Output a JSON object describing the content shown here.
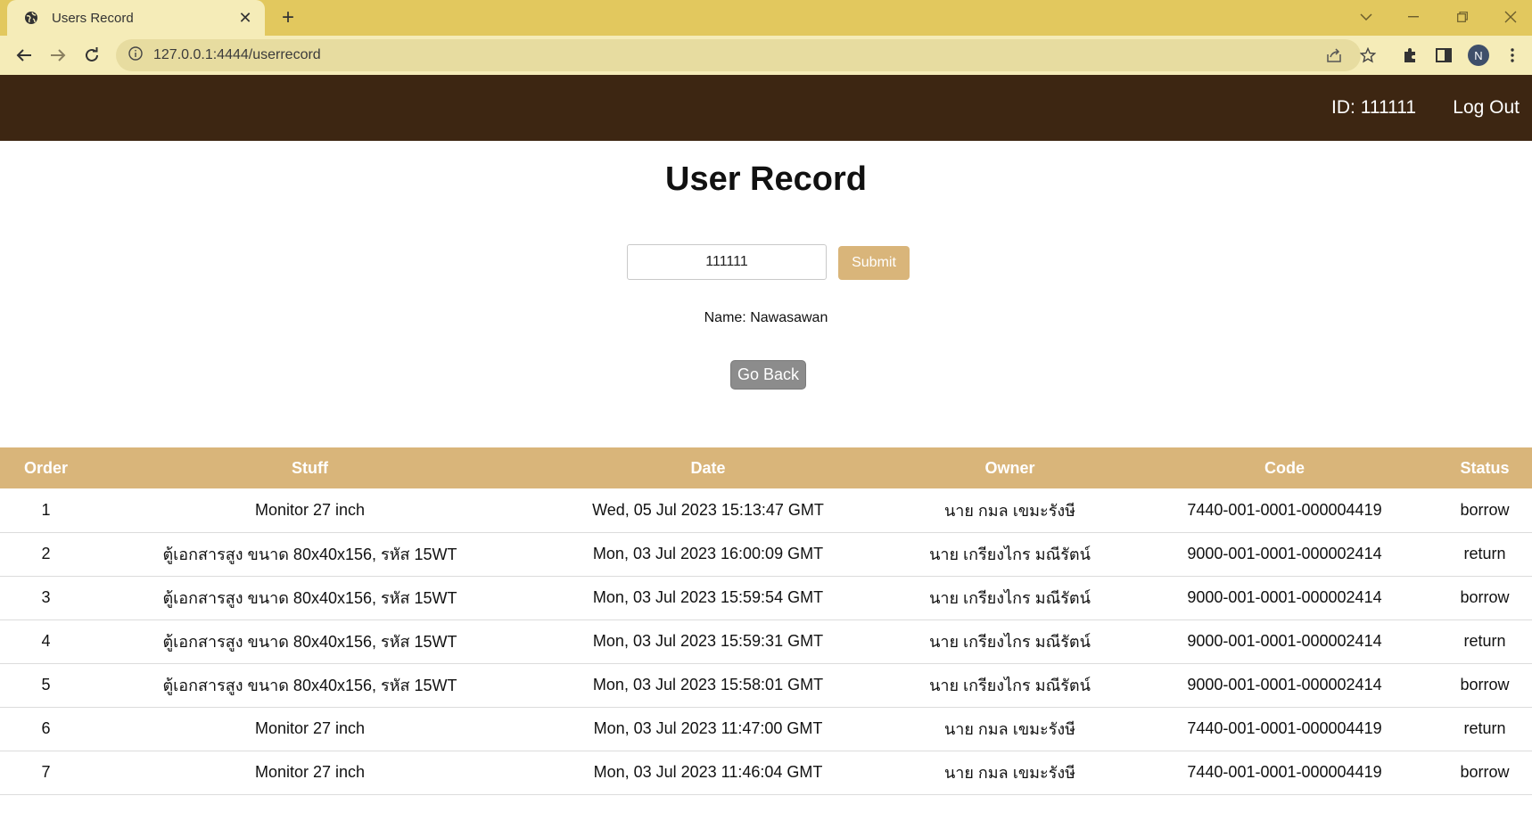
{
  "browser": {
    "tab_title": "Users Record",
    "url": "127.0.0.1:4444/userrecord",
    "profile_initial": "N"
  },
  "header": {
    "user_id": "ID: 111111",
    "logout_label": "Log Out"
  },
  "page": {
    "title": "User Record",
    "search_value": "111111",
    "submit_label": "Submit",
    "name_text": "Name: Nawasawan",
    "back_label": "Go Back"
  },
  "table": {
    "columns": [
      "Order",
      "Stuff",
      "Date",
      "Owner",
      "Code",
      "Status"
    ],
    "rows": [
      [
        "1",
        "Monitor 27 inch",
        "Wed, 05 Jul 2023 15:13:47 GMT",
        "นาย กมล เขมะรังษี",
        "7440-001-0001-000004419",
        "borrow"
      ],
      [
        "2",
        "ตู้เอกสารสูง ขนาด 80x40x156, รหัส 15WT",
        "Mon, 03 Jul 2023 16:00:09 GMT",
        "นาย เกรียงไกร มณีรัตน์",
        "9000-001-0001-000002414",
        "return"
      ],
      [
        "3",
        "ตู้เอกสารสูง ขนาด 80x40x156, รหัส 15WT",
        "Mon, 03 Jul 2023 15:59:54 GMT",
        "นาย เกรียงไกร มณีรัตน์",
        "9000-001-0001-000002414",
        "borrow"
      ],
      [
        "4",
        "ตู้เอกสารสูง ขนาด 80x40x156, รหัส 15WT",
        "Mon, 03 Jul 2023 15:59:31 GMT",
        "นาย เกรียงไกร มณีรัตน์",
        "9000-001-0001-000002414",
        "return"
      ],
      [
        "5",
        "ตู้เอกสารสูง ขนาด 80x40x156, รหัส 15WT",
        "Mon, 03 Jul 2023 15:58:01 GMT",
        "นาย เกรียงไกร มณีรัตน์",
        "9000-001-0001-000002414",
        "borrow"
      ],
      [
        "6",
        "Monitor 27 inch",
        "Mon, 03 Jul 2023 11:47:00 GMT",
        "นาย กมล เขมะรังษี",
        "7440-001-0001-000004419",
        "return"
      ],
      [
        "7",
        "Monitor 27 inch",
        "Mon, 03 Jul 2023 11:46:04 GMT",
        "นาย กมล เขมะรังษี",
        "7440-001-0001-000004419",
        "borrow"
      ]
    ]
  },
  "colors": {
    "tabbar": "#e2c85e",
    "appbar": "#3d2612",
    "accent": "#d9b57a",
    "back_button": "#8c8c8c"
  },
  "icons": {
    "tab_favicon": "globe-icon",
    "new_tab": "plus-icon",
    "back": "arrow-left-icon",
    "forward": "arrow-right-icon",
    "reload": "reload-icon",
    "site_info": "info-icon",
    "share": "share-icon",
    "bookmark": "star-icon",
    "extensions": "puzzle-icon",
    "side_panel": "side-panel-icon",
    "menu": "kebab-menu-icon"
  }
}
